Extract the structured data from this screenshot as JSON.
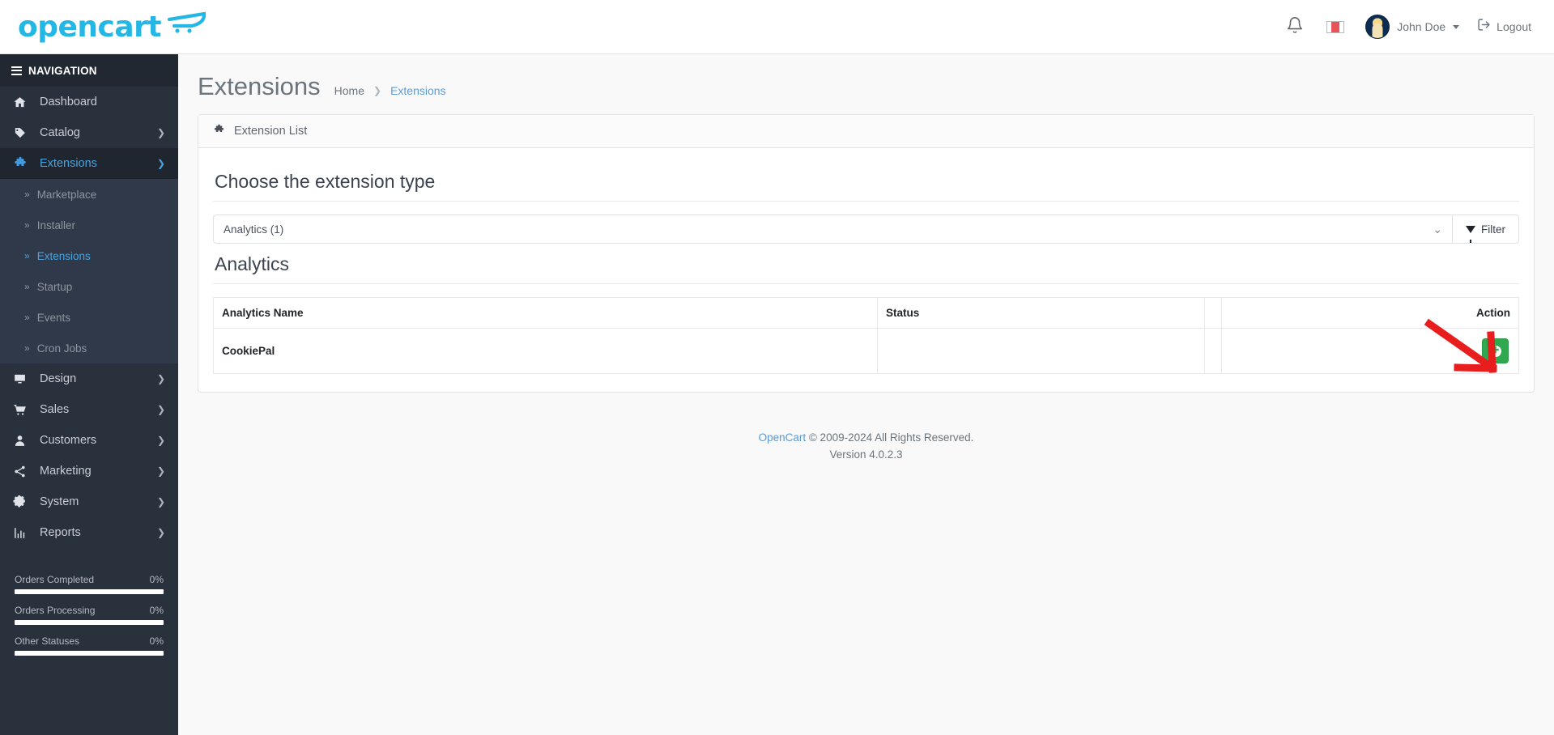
{
  "header": {
    "logo_text": "opencart",
    "notification_icon": "bell-icon",
    "language_flag_icon": "flag-icon",
    "user_name": "John Doe",
    "logout_label": "Logout"
  },
  "sidebar": {
    "nav_header": "NAVIGATION",
    "items": [
      {
        "label": "Dashboard",
        "icon": "home-icon",
        "has_chevron": false,
        "active": false
      },
      {
        "label": "Catalog",
        "icon": "tag-icon",
        "has_chevron": true,
        "active": false
      },
      {
        "label": "Extensions",
        "icon": "puzzle-icon",
        "has_chevron": true,
        "active": true
      }
    ],
    "subitems": [
      {
        "label": "Marketplace",
        "active": false
      },
      {
        "label": "Installer",
        "active": false
      },
      {
        "label": "Extensions",
        "active": true
      },
      {
        "label": "Startup",
        "active": false
      },
      {
        "label": "Events",
        "active": false
      },
      {
        "label": "Cron Jobs",
        "active": false
      }
    ],
    "items_after": [
      {
        "label": "Design",
        "icon": "monitor-icon",
        "has_chevron": true,
        "active": false
      },
      {
        "label": "Sales",
        "icon": "cart-icon",
        "has_chevron": true,
        "active": false
      },
      {
        "label": "Customers",
        "icon": "user-icon",
        "has_chevron": true,
        "active": false
      },
      {
        "label": "Marketing",
        "icon": "share-icon",
        "has_chevron": true,
        "active": false
      },
      {
        "label": "System",
        "icon": "gear-icon",
        "has_chevron": true,
        "active": false
      },
      {
        "label": "Reports",
        "icon": "chart-icon",
        "has_chevron": true,
        "active": false
      }
    ],
    "stats": [
      {
        "label": "Orders Completed",
        "value": "0%",
        "percent": 100
      },
      {
        "label": "Orders Processing",
        "value": "0%",
        "percent": 100
      },
      {
        "label": "Other Statuses",
        "value": "0%",
        "percent": 100
      }
    ]
  },
  "page": {
    "title": "Extensions",
    "breadcrumb": [
      {
        "label": "Home",
        "current": false
      },
      {
        "label": "Extensions",
        "current": true
      }
    ]
  },
  "card": {
    "head_icon": "puzzle-icon",
    "head_title": "Extension List",
    "choose_title": "Choose the extension type",
    "select_value": "Analytics (1)",
    "filter_label": "Filter",
    "section_title": "Analytics"
  },
  "table": {
    "columns": [
      "Analytics Name",
      "Status",
      "",
      "Action"
    ],
    "rows": [
      {
        "name": "CookiePal",
        "status": "",
        "action_icon": "install-plus-icon"
      }
    ]
  },
  "annotation": {
    "arrow_color": "#e81d1d",
    "points_to": "install-button"
  },
  "footer": {
    "link_label": "OpenCart",
    "copyright": "© 2009-2024 All Rights Reserved.",
    "version": "Version 4.0.2.3"
  },
  "colors": {
    "accent": "#23b7e5",
    "sidebar_bg": "#29313d",
    "sidebar_sub_bg": "#303949",
    "link": "#5b9bd5",
    "install_green": "#2fa84f"
  }
}
